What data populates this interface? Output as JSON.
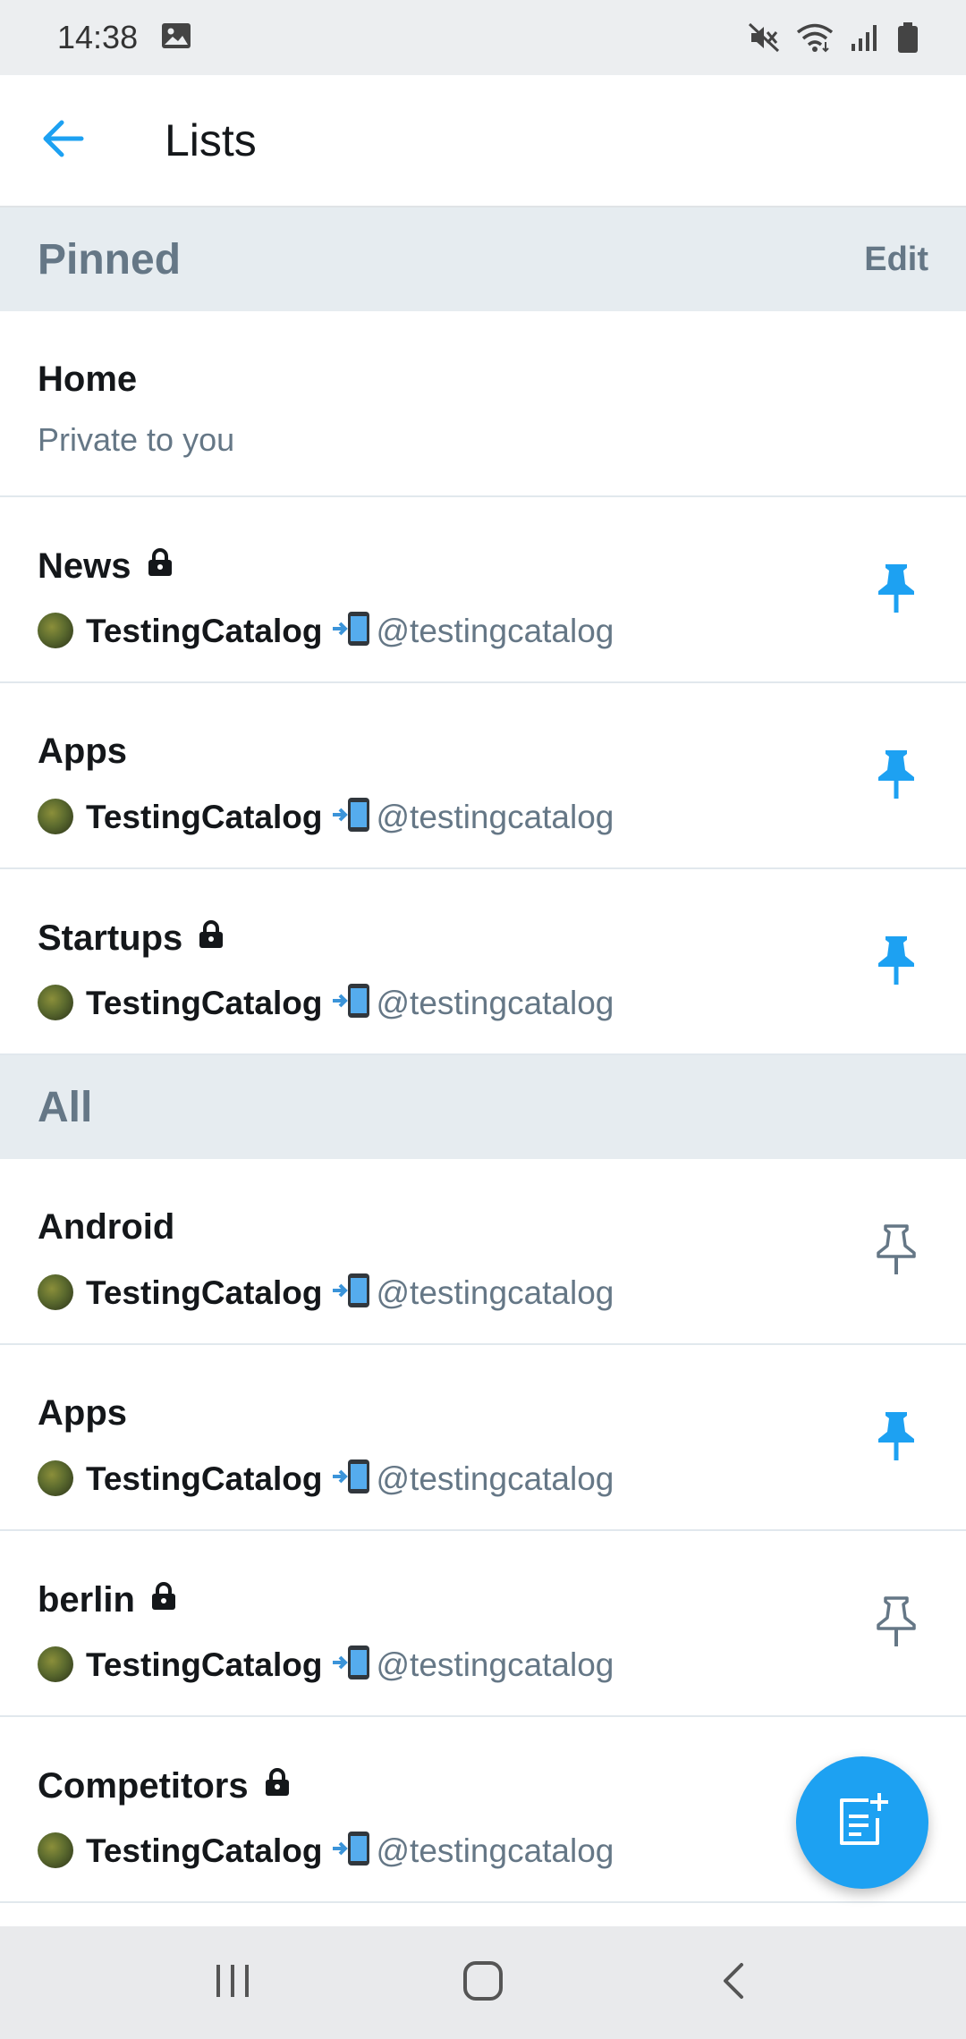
{
  "status_bar": {
    "time": "14:38",
    "icons": [
      "image-icon",
      "mute-icon",
      "wifi-icon",
      "signal-icon",
      "battery-icon"
    ]
  },
  "header": {
    "title": "Lists",
    "back_icon": "arrow-left-icon"
  },
  "pinned_section": {
    "title": "Pinned",
    "edit_label": "Edit"
  },
  "home_list": {
    "name": "Home",
    "subtitle": "Private to you"
  },
  "pinned_lists": [
    {
      "name": "News",
      "private": true,
      "owner_name": "TestingCatalog",
      "owner_handle": "@testingcatalog",
      "pinned": true
    },
    {
      "name": "Apps",
      "private": false,
      "owner_name": "TestingCatalog",
      "owner_handle": "@testingcatalog",
      "pinned": true
    },
    {
      "name": "Startups",
      "private": true,
      "owner_name": "TestingCatalog",
      "owner_handle": "@testingcatalog",
      "pinned": true
    }
  ],
  "all_section": {
    "title": "All"
  },
  "all_lists": [
    {
      "name": "Android",
      "private": false,
      "owner_name": "TestingCatalog",
      "owner_handle": "@testingcatalog",
      "pinned": false
    },
    {
      "name": "Apps",
      "private": false,
      "owner_name": "TestingCatalog",
      "owner_handle": "@testingcatalog",
      "pinned": true
    },
    {
      "name": "berlin",
      "private": true,
      "owner_name": "TestingCatalog",
      "owner_handle": "@testingcatalog",
      "pinned": false
    },
    {
      "name": "Competitors",
      "private": true,
      "owner_name": "TestingCatalog",
      "owner_handle": "@testingcatalog",
      "pinned": null
    }
  ],
  "fab": {
    "icon": "new-list-icon"
  },
  "nav_bar": {
    "icons": [
      "recent-apps-icon",
      "home-icon",
      "back-icon"
    ]
  },
  "colors": {
    "accent": "#1da1f2",
    "muted": "#657786",
    "section_bg": "#e6ecf0"
  }
}
